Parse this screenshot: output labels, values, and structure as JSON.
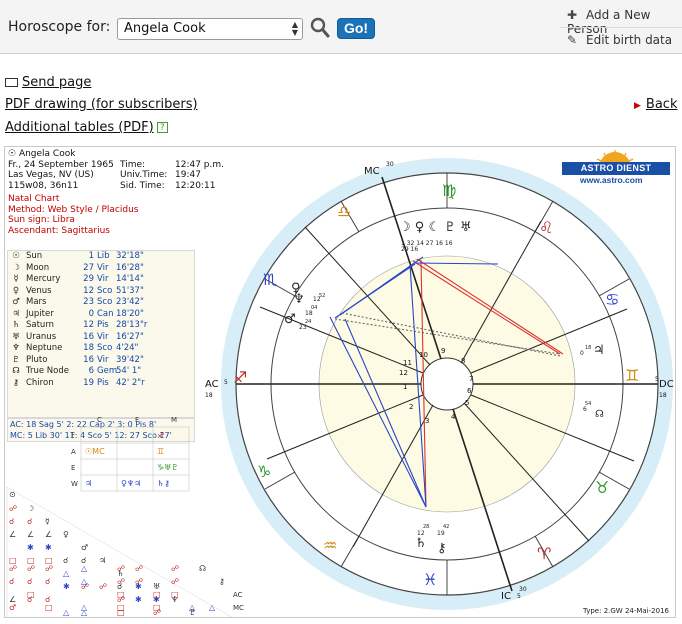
{
  "topbar": {
    "label": "Horoscope for:",
    "selected_person": "Angela Cook",
    "go_label": "Go!",
    "add_person": "Add a New Person",
    "edit_birth": "Edit birth data"
  },
  "links": {
    "send_page": "Send page",
    "pdf_drawing": "PDF drawing (for subscribers)",
    "additional_tables": "Additional tables (PDF)",
    "back": "Back"
  },
  "chart": {
    "name": "Angela Cook",
    "date_line": "Fr., 24 September 1965",
    "place": "Las Vegas, NV (US)",
    "coords": "115w08, 36n11",
    "time_label": "Time:",
    "time_value": "12:47 p.m.",
    "ut_label": "Univ.Time:",
    "ut_value": "19:47",
    "sid_label": "Sid. Time:",
    "sid_value": "12:20:11",
    "chart_type": "Natal Chart",
    "method": "Method: Web Style / Placidus",
    "sun_sign": "Sun sign: Libra",
    "ascendant": "Ascendant: Sagittarius",
    "logo_text": "ASTRO DIENST",
    "logo_url": "www.astro.com",
    "footer": "Type: 2.GW    24-Mai-2016",
    "angle_labels": {
      "mc": "MC",
      "ic": "IC",
      "ac": "AC",
      "dc": "DC",
      "mc_deg": "30",
      "ic_deg": "30",
      "ac_deg": "18",
      "dc_deg": "18",
      "ac_min": "5",
      "dc_min": "5",
      "ic_min": "5"
    },
    "planets": [
      {
        "glyph": "☉",
        "name": "Sun",
        "deg": "1",
        "sign": "Lib",
        "min": "32'18\""
      },
      {
        "glyph": "☽",
        "name": "Moon",
        "deg": "27",
        "sign": "Vir",
        "min": "16'28\""
      },
      {
        "glyph": "☿",
        "name": "Mercury",
        "deg": "29",
        "sign": "Vir",
        "min": "14'14\""
      },
      {
        "glyph": "♀",
        "name": "Venus",
        "deg": "12",
        "sign": "Sco",
        "min": "51'37\""
      },
      {
        "glyph": "♂",
        "name": "Mars",
        "deg": "23",
        "sign": "Sco",
        "min": "23'42\""
      },
      {
        "glyph": "♃",
        "name": "Jupiter",
        "deg": "0",
        "sign": "Can",
        "min": "18'20\""
      },
      {
        "glyph": "♄",
        "name": "Saturn",
        "deg": "12",
        "sign": "Pis",
        "min": "28'13\"r"
      },
      {
        "glyph": "♅",
        "name": "Uranus",
        "deg": "16",
        "sign": "Vir",
        "min": "16'27\""
      },
      {
        "glyph": "♆",
        "name": "Neptune",
        "deg": "18",
        "sign": "Sco",
        "min": "4'24\""
      },
      {
        "glyph": "♇",
        "name": "Pluto",
        "deg": "16",
        "sign": "Vir",
        "min": "39'42\""
      },
      {
        "glyph": "☊",
        "name": "True Node",
        "deg": "6",
        "sign": "Gem",
        "min": "54'  1\""
      },
      {
        "glyph": "⚷",
        "name": "Chiron",
        "deg": "19",
        "sign": "Pis",
        "min": "42'  2\"r"
      }
    ],
    "houses": [
      "AC: 18 Sag   5'   2: 22 Cap   2'   3:   0 Pis   8'",
      "MC:   5 Lib  30'  11:   4 Sco   5'  12: 27 Sco 17'"
    ],
    "grid_header": [
      "C",
      "F",
      "M"
    ],
    "grid_rows": [
      "F",
      "A",
      "E",
      "W"
    ],
    "house_numbers": [
      "1",
      "2",
      "3",
      "4",
      "5",
      "6",
      "7",
      "8",
      "9",
      "10",
      "11",
      "12"
    ],
    "corner_labels": {
      "ac": "AC",
      "mc": "MC"
    }
  },
  "colors": {
    "accent": "#1a73b8",
    "red_text": "#c00000",
    "blue_text": "#1546a8",
    "wheel_ring": "#cfe9f6",
    "wheel_inner": "#fdfbe4"
  }
}
